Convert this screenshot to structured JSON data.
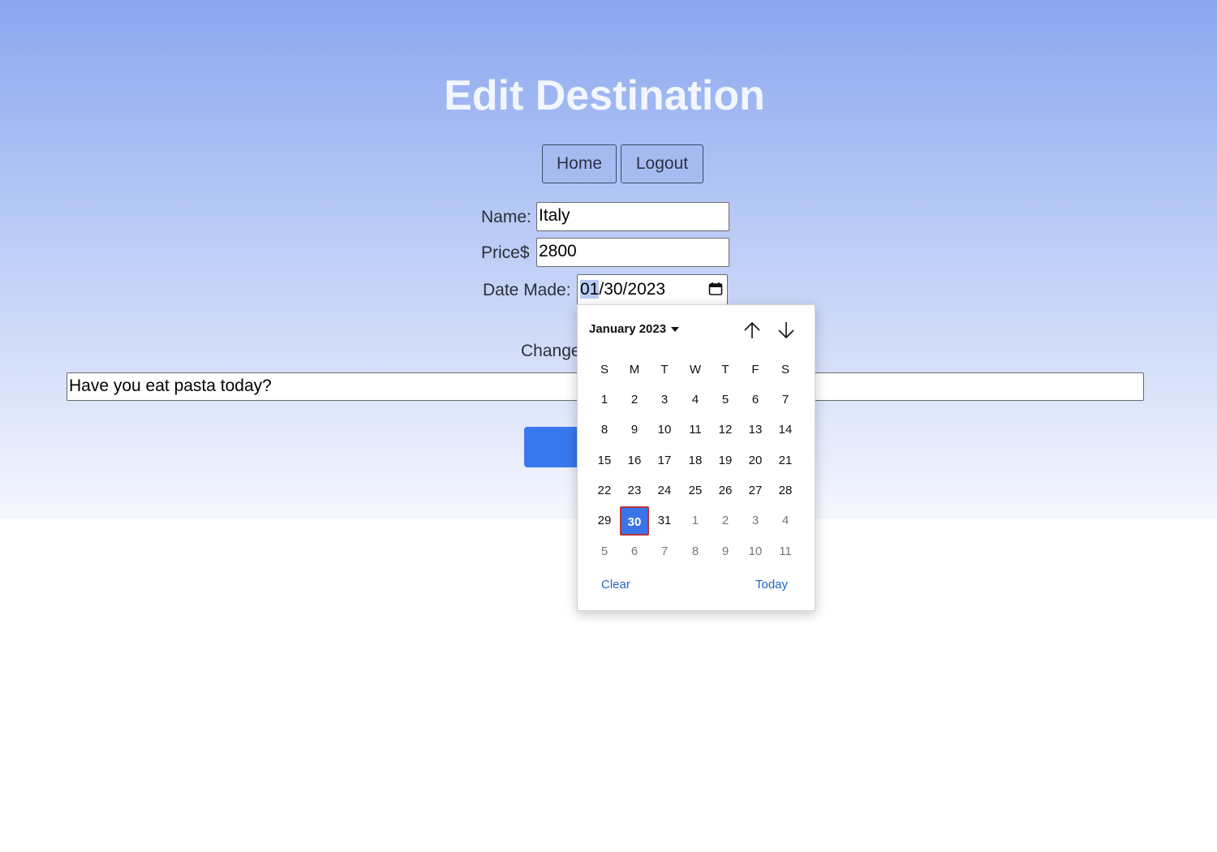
{
  "page": {
    "title": "Edit Destination",
    "nav": {
      "home_label": "Home",
      "logout_label": "Logout"
    }
  },
  "form": {
    "name_label": "Name:",
    "name_value": "Italy",
    "price_label": "Price$",
    "price_value": "2800",
    "date_label": "Date Made:",
    "date_month": "01",
    "date_rest": "/30/2023",
    "description_label_visible": "Change",
    "description_value": "Have you eat pasta today?"
  },
  "datepicker": {
    "month_label": "January 2023",
    "weekdays": [
      "S",
      "M",
      "T",
      "W",
      "T",
      "F",
      "S"
    ],
    "weeks": [
      [
        1,
        2,
        3,
        4,
        5,
        6,
        7
      ],
      [
        8,
        9,
        10,
        11,
        12,
        13,
        14
      ],
      [
        15,
        16,
        17,
        18,
        19,
        20,
        21
      ],
      [
        22,
        23,
        24,
        25,
        26,
        27,
        28
      ],
      [
        29,
        30,
        31,
        1,
        2,
        3,
        4
      ],
      [
        5,
        6,
        7,
        8,
        9,
        10,
        11
      ]
    ],
    "selected_day": 30,
    "clear_label": "Clear",
    "today_label": "Today"
  },
  "icons": {
    "calendar": "calendar-icon",
    "month_dropdown": "caret-down-icon",
    "prev": "arrow-up-icon",
    "next": "arrow-down-icon"
  },
  "colors": {
    "gradient_top": "#8aa7ef",
    "gradient_bottom": "#f5f7fe",
    "submit_button": "#3977ee",
    "selected_day": "#3b74e8",
    "link": "#1a66c9"
  }
}
